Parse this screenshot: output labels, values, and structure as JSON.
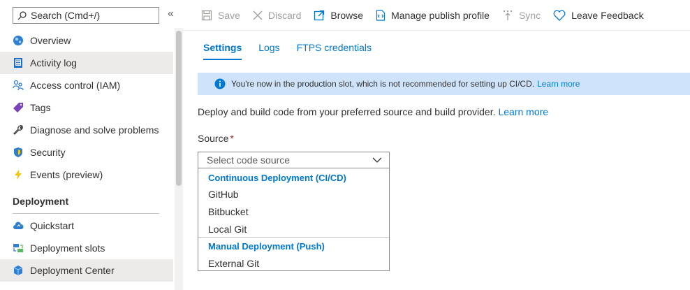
{
  "sidebar": {
    "search_placeholder": "Search (Cmd+/)",
    "collapse_glyph": "«",
    "items": [
      {
        "label": "Overview",
        "icon": "globe-icon"
      },
      {
        "label": "Activity log",
        "icon": "log-icon"
      },
      {
        "label": "Access control (IAM)",
        "icon": "people-icon"
      },
      {
        "label": "Tags",
        "icon": "tag-icon"
      },
      {
        "label": "Diagnose and solve problems",
        "icon": "wrench-icon"
      },
      {
        "label": "Security",
        "icon": "shield-icon"
      },
      {
        "label": "Events (preview)",
        "icon": "lightning-icon"
      }
    ],
    "section_title": "Deployment",
    "deployment_items": [
      {
        "label": "Quickstart",
        "icon": "cloud-icon"
      },
      {
        "label": "Deployment slots",
        "icon": "slots-icon"
      },
      {
        "label": "Deployment Center",
        "icon": "cube-icon"
      }
    ]
  },
  "toolbar": {
    "save": "Save",
    "discard": "Discard",
    "browse": "Browse",
    "manage_publish_profile": "Manage publish profile",
    "sync": "Sync",
    "leave_feedback": "Leave Feedback"
  },
  "tabs": [
    "Settings",
    "Logs",
    "FTPS credentials"
  ],
  "banner": {
    "text": "You're now in the production slot, which is not recommended for setting up CI/CD.",
    "link": "Learn more"
  },
  "description": {
    "text": "Deploy and build code from your preferred source and build provider.",
    "link": "Learn more"
  },
  "source": {
    "label": "Source",
    "required_mark": "*",
    "placeholder": "Select code source",
    "groups": [
      {
        "header": "Continuous Deployment (CI/CD)",
        "options": [
          "GitHub",
          "Bitbucket",
          "Local Git"
        ]
      },
      {
        "header": "Manual Deployment (Push)",
        "options": [
          "External Git"
        ]
      }
    ]
  },
  "colors": {
    "accent": "#0078d4",
    "banner_bg": "#cfe4fa",
    "selected_nav_bg": "#edebe9"
  }
}
